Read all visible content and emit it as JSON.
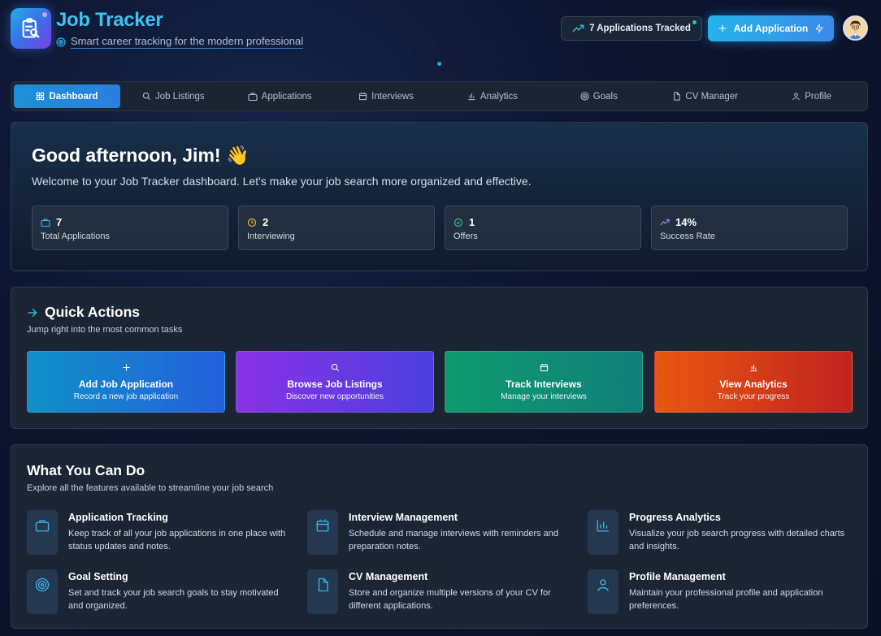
{
  "header": {
    "title": "Job Tracker",
    "subtitle": "Smart career tracking for the modern professional",
    "tracked_label": "7 Applications Tracked",
    "add_label": "Add Application"
  },
  "nav": {
    "items": [
      {
        "label": "Dashboard",
        "icon": "grid-icon"
      },
      {
        "label": "Job Listings",
        "icon": "search-icon"
      },
      {
        "label": "Applications",
        "icon": "briefcase-icon"
      },
      {
        "label": "Interviews",
        "icon": "calendar-icon"
      },
      {
        "label": "Analytics",
        "icon": "bar-chart-icon"
      },
      {
        "label": "Goals",
        "icon": "target-icon"
      },
      {
        "label": "CV Manager",
        "icon": "document-icon"
      },
      {
        "label": "Profile",
        "icon": "user-icon"
      }
    ]
  },
  "hero": {
    "greeting": "Good afternoon, Jim! 👋",
    "welcome": "Welcome to your Job Tracker dashboard. Let's make your job search more organized and effective.",
    "stats": [
      {
        "value": "7",
        "label": "Total Applications",
        "color": "#3ab8ea"
      },
      {
        "value": "2",
        "label": "Interviewing",
        "color": "#f0b429"
      },
      {
        "value": "1",
        "label": "Offers",
        "color": "#34c08a"
      },
      {
        "value": "14%",
        "label": "Success Rate",
        "color": "#b37cf0"
      }
    ]
  },
  "quick_actions": {
    "title": "Quick Actions",
    "subtitle": "Jump right into the most common tasks",
    "tiles": [
      {
        "title": "Add Job Application",
        "sub": "Record a new job application"
      },
      {
        "title": "Browse Job Listings",
        "sub": "Discover new opportunities"
      },
      {
        "title": "Track Interviews",
        "sub": "Manage your interviews"
      },
      {
        "title": "View Analytics",
        "sub": "Track your progress"
      }
    ]
  },
  "features": {
    "title": "What You Can Do",
    "subtitle": "Explore all the features available to streamline your job search",
    "items": [
      {
        "title": "Application Tracking",
        "desc": "Keep track of all your job applications in one place with status updates and notes."
      },
      {
        "title": "Interview Management",
        "desc": "Schedule and manage interviews with reminders and preparation notes."
      },
      {
        "title": "Progress Analytics",
        "desc": "Visualize your job search progress with detailed charts and insights."
      },
      {
        "title": "Goal Setting",
        "desc": "Set and track your job search goals to stay motivated and organized."
      },
      {
        "title": "CV Management",
        "desc": "Store and organize multiple versions of your CV for different applications."
      },
      {
        "title": "Profile Management",
        "desc": "Maintain your professional profile and application preferences."
      }
    ]
  }
}
